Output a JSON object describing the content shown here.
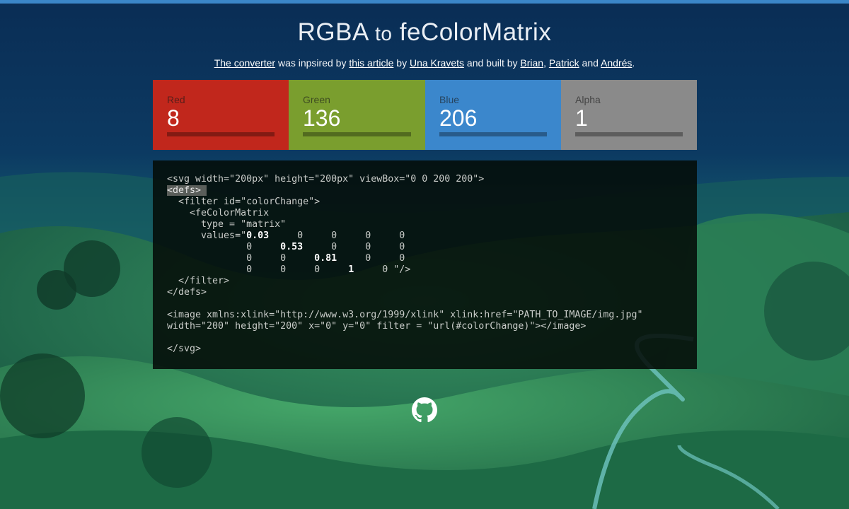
{
  "page": {
    "title_main": "RGBA",
    "title_to": "to",
    "title_end": "feColorMatrix"
  },
  "credits": {
    "link_converter": "The converter",
    "text_1": " was inpsired by ",
    "link_article": "this article",
    "text_2": " by ",
    "link_una": "Una Kravets",
    "text_3": " and built by ",
    "link_brian": "Brian",
    "text_4": ", ",
    "link_patrick": "Patrick",
    "text_5": " and ",
    "link_andres": "Andrés",
    "text_6": "."
  },
  "channels": [
    {
      "label": "Red",
      "value": "8",
      "color": "#c1271c",
      "level": 0.03
    },
    {
      "label": "Green",
      "value": "136",
      "color": "#7a9e2e",
      "level": 0.53
    },
    {
      "label": "Blue",
      "value": "206",
      "color": "#3b87cc",
      "level": 0.81
    },
    {
      "label": "Alpha",
      "value": "1",
      "color": "#8a8a8a",
      "level": 1
    }
  ],
  "code": {
    "l1": "<svg width=\"200px\" height=\"200px\" viewBox=\"0 0 200 200\">",
    "l2_sel": "<defs> ",
    "l3": "  <filter id=\"colorChange\">",
    "l4": "    <feColorMatrix",
    "l5": "      type = \"matrix\"",
    "l6_pre": "      values=\"",
    "m00": "0.03",
    "row0_rest": "     0     0     0     0",
    "row1_pre": "              0     ",
    "m11": "0.53",
    "row1_rest": "     0     0     0",
    "row2_pre": "              0     0     ",
    "m22": "0.81",
    "row2_rest": "     0     0",
    "row3_pre": "              0     0     0     ",
    "m33": "1",
    "row3_rest": "     0 \"/>",
    "l11": "  </filter>",
    "l12": "</defs>",
    "l14": "<image xmlns:xlink=\"http://www.w3.org/1999/xlink\" xlink:href=\"PATH_TO_IMAGE/img.jpg\"",
    "l15": "width=\"200\" height=\"200\" x=\"0\" y=\"0\" filter = \"url(#colorChange)\"></image>",
    "l17": "</svg>"
  },
  "icons": {
    "github": "github-icon",
    "accent": "#3b86c8"
  }
}
